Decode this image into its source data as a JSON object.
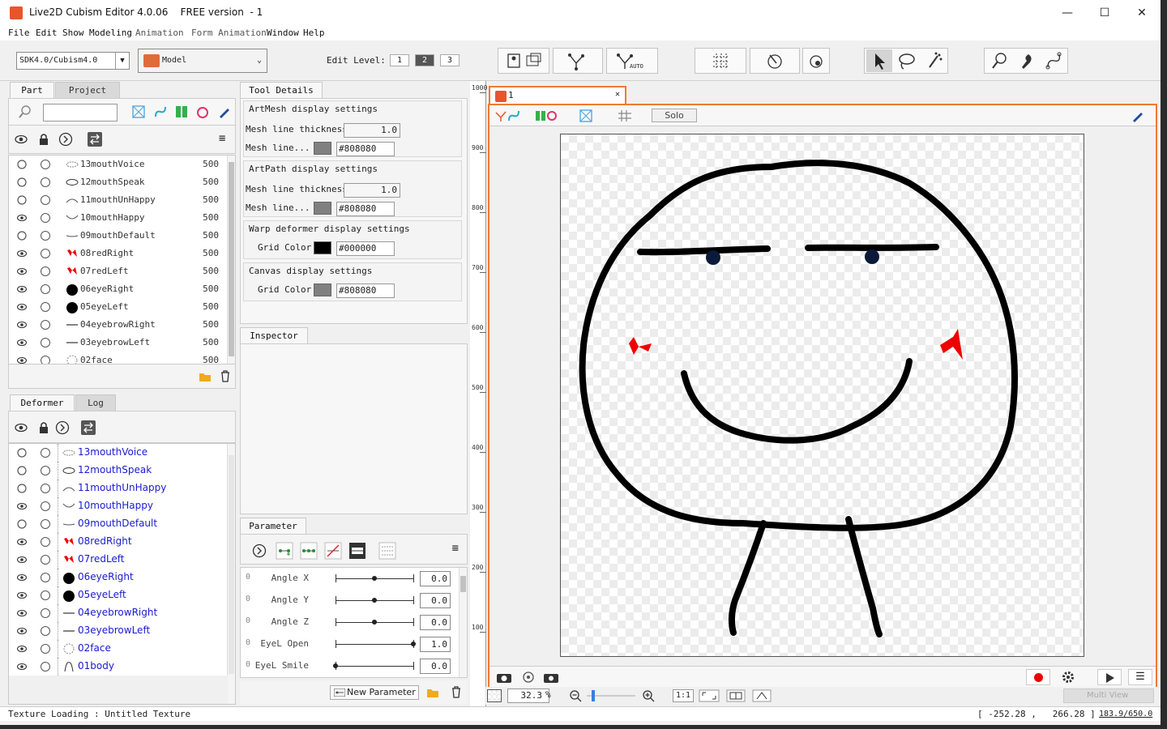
{
  "app": {
    "title": "Live2D Cubism Editor 4.0.06    FREE version  - 1",
    "minimize": "—",
    "maximize": "☐",
    "close": "✕"
  },
  "menu": [
    "File",
    "Edit",
    "Show",
    "Modeling",
    "Animation",
    "Form Animation",
    "Window",
    "Help"
  ],
  "toolbar": {
    "sdk_select": "SDK4.0/Cubism4.0",
    "mode_select": "Model",
    "edit_level_label": "Edit Level:",
    "levels": [
      "1",
      "2",
      "3"
    ],
    "active_level": "2",
    "auto_label": "AUTO"
  },
  "part_panel": {
    "tabs": [
      "Part",
      "Project"
    ],
    "items": [
      {
        "name": "13mouthVoice",
        "value": "500",
        "eye": false
      },
      {
        "name": "12mouthSpeak",
        "value": "500",
        "eye": false
      },
      {
        "name": "11mouthUnHappy",
        "value": "500",
        "eye": false
      },
      {
        "name": "10mouthHappy",
        "value": "500",
        "eye": true
      },
      {
        "name": "09mouthDefault",
        "value": "500",
        "eye": false
      },
      {
        "name": "08redRight",
        "value": "500",
        "eye": true
      },
      {
        "name": "07redLeft",
        "value": "500",
        "eye": true
      },
      {
        "name": "06eyeRight",
        "value": "500",
        "eye": true
      },
      {
        "name": "05eyeLeft",
        "value": "500",
        "eye": true
      },
      {
        "name": "04eyebrowRight",
        "value": "500",
        "eye": true
      },
      {
        "name": "03eyebrowLeft",
        "value": "500",
        "eye": true
      },
      {
        "name": "02face",
        "value": "500",
        "eye": true
      }
    ]
  },
  "deformer_panel": {
    "tabs": [
      "Deformer",
      "Log"
    ],
    "items": [
      {
        "name": "13mouthVoice",
        "eye": false
      },
      {
        "name": "12mouthSpeak",
        "eye": false
      },
      {
        "name": "11mouthUnHappy",
        "eye": false
      },
      {
        "name": "10mouthHappy",
        "eye": true
      },
      {
        "name": "09mouthDefault",
        "eye": false
      },
      {
        "name": "08redRight",
        "eye": true
      },
      {
        "name": "07redLeft",
        "eye": true
      },
      {
        "name": "06eyeRight",
        "eye": true
      },
      {
        "name": "05eyeLeft",
        "eye": true
      },
      {
        "name": "04eyebrowRight",
        "eye": true
      },
      {
        "name": "03eyebrowLeft",
        "eye": true
      },
      {
        "name": "02face",
        "eye": true
      },
      {
        "name": "01body",
        "eye": true
      }
    ]
  },
  "tool_details": {
    "tab": "Tool Details",
    "artmesh_title": "ArtMesh display settings",
    "artmesh_thickness_label": "Mesh line thickness",
    "artmesh_thickness_value": "1.0",
    "artmesh_color_label": "Mesh line...",
    "artmesh_color_value": "#808080",
    "artpath_title": "ArtPath display settings",
    "artpath_thickness_label": "Mesh line thickness",
    "artpath_thickness_value": "1.0",
    "artpath_color_label": "Mesh line...",
    "artpath_color_value": "#808080",
    "warp_title": "Warp deformer display settings",
    "warp_grid_label": "Grid Color",
    "warp_grid_value": "#000000",
    "canvas_title": "Canvas display settings",
    "canvas_grid_label": "Grid Color",
    "canvas_grid_value": "#808080"
  },
  "inspector": {
    "tab": "Inspector"
  },
  "parameter": {
    "tab": "Parameter",
    "rows": [
      {
        "name": "Angle X",
        "value": "0.0",
        "knob": 0.5
      },
      {
        "name": "Angle Y",
        "value": "0.0",
        "knob": 0.5
      },
      {
        "name": "Angle Z",
        "value": "0.0",
        "knob": 0.5
      },
      {
        "name": "EyeL Open",
        "value": "1.0",
        "knob": 1.0
      },
      {
        "name": "EyeL Smile",
        "value": "0.0",
        "knob": 0.0
      }
    ],
    "new_button": "New Parameter",
    "zero_mark": "0"
  },
  "viewport": {
    "tab_title": "1",
    "solo_label": "Solo",
    "zoom_value": "32.3",
    "zoom_unit": "%",
    "one_to_one": "1:1",
    "multi_view": "Multi View",
    "ruler_ticks": [
      "1000",
      "900",
      "800",
      "700",
      "600",
      "500",
      "400",
      "300",
      "200",
      "100"
    ]
  },
  "status": {
    "left": "Texture Loading : Untitled Texture",
    "coords": "[ -252.28 ,   266.28 ]",
    "pos": "183.9/650.0"
  },
  "colors": {
    "accent_orange": "#f07a30",
    "app_icon": "#e8552d",
    "deformer_text": "#1a1ad0"
  }
}
